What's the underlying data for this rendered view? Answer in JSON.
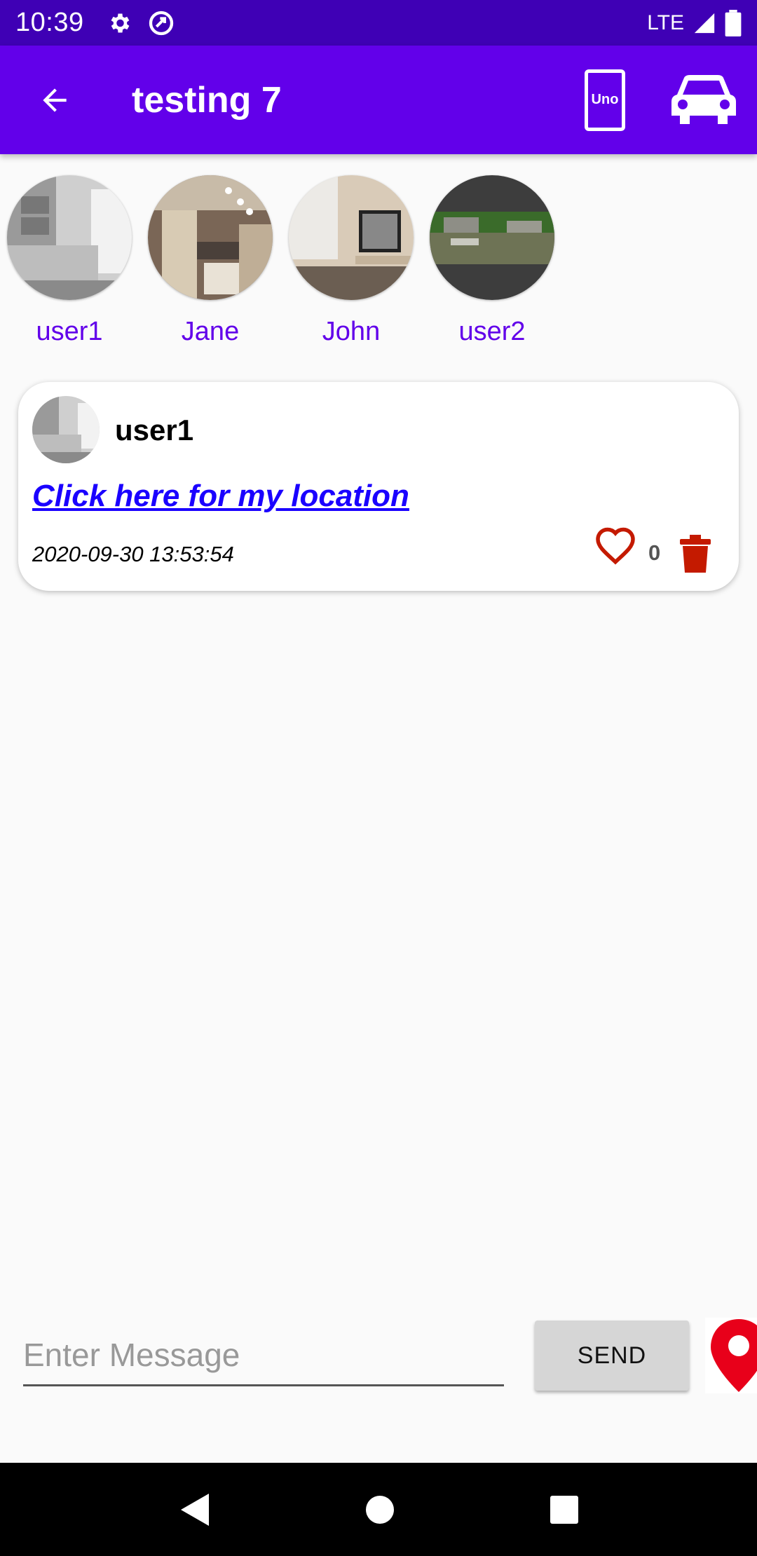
{
  "status_bar": {
    "time": "10:39",
    "network": "LTE"
  },
  "app_bar": {
    "title": "testing 7",
    "uno_label": "Uno",
    "color": "#6200ea"
  },
  "users": [
    {
      "name": "user1",
      "photo": "living room grayscale"
    },
    {
      "name": "Jane",
      "photo": "kitchen"
    },
    {
      "name": "John",
      "photo": "room with tv"
    },
    {
      "name": "user2",
      "photo": "river landscape"
    }
  ],
  "message": {
    "user": "user1",
    "link_text": "Click here for my location",
    "timestamp": "2020-09-30 13:53:54",
    "likes": "0"
  },
  "composer": {
    "placeholder": "Enter Message",
    "send_label": "SEND"
  },
  "colors": {
    "accent": "#6200ea",
    "status_bar": "#3f00b5",
    "link": "#1a00ff",
    "danger": "#c41a00"
  },
  "icons": [
    "back-arrow-icon",
    "uno-card-icon",
    "car-icon",
    "heart-icon",
    "trash-icon",
    "location-pin-icon",
    "settings-icon",
    "sync-icon",
    "signal-icon",
    "battery-icon",
    "nav-back-icon",
    "nav-home-icon",
    "nav-recents-icon"
  ]
}
